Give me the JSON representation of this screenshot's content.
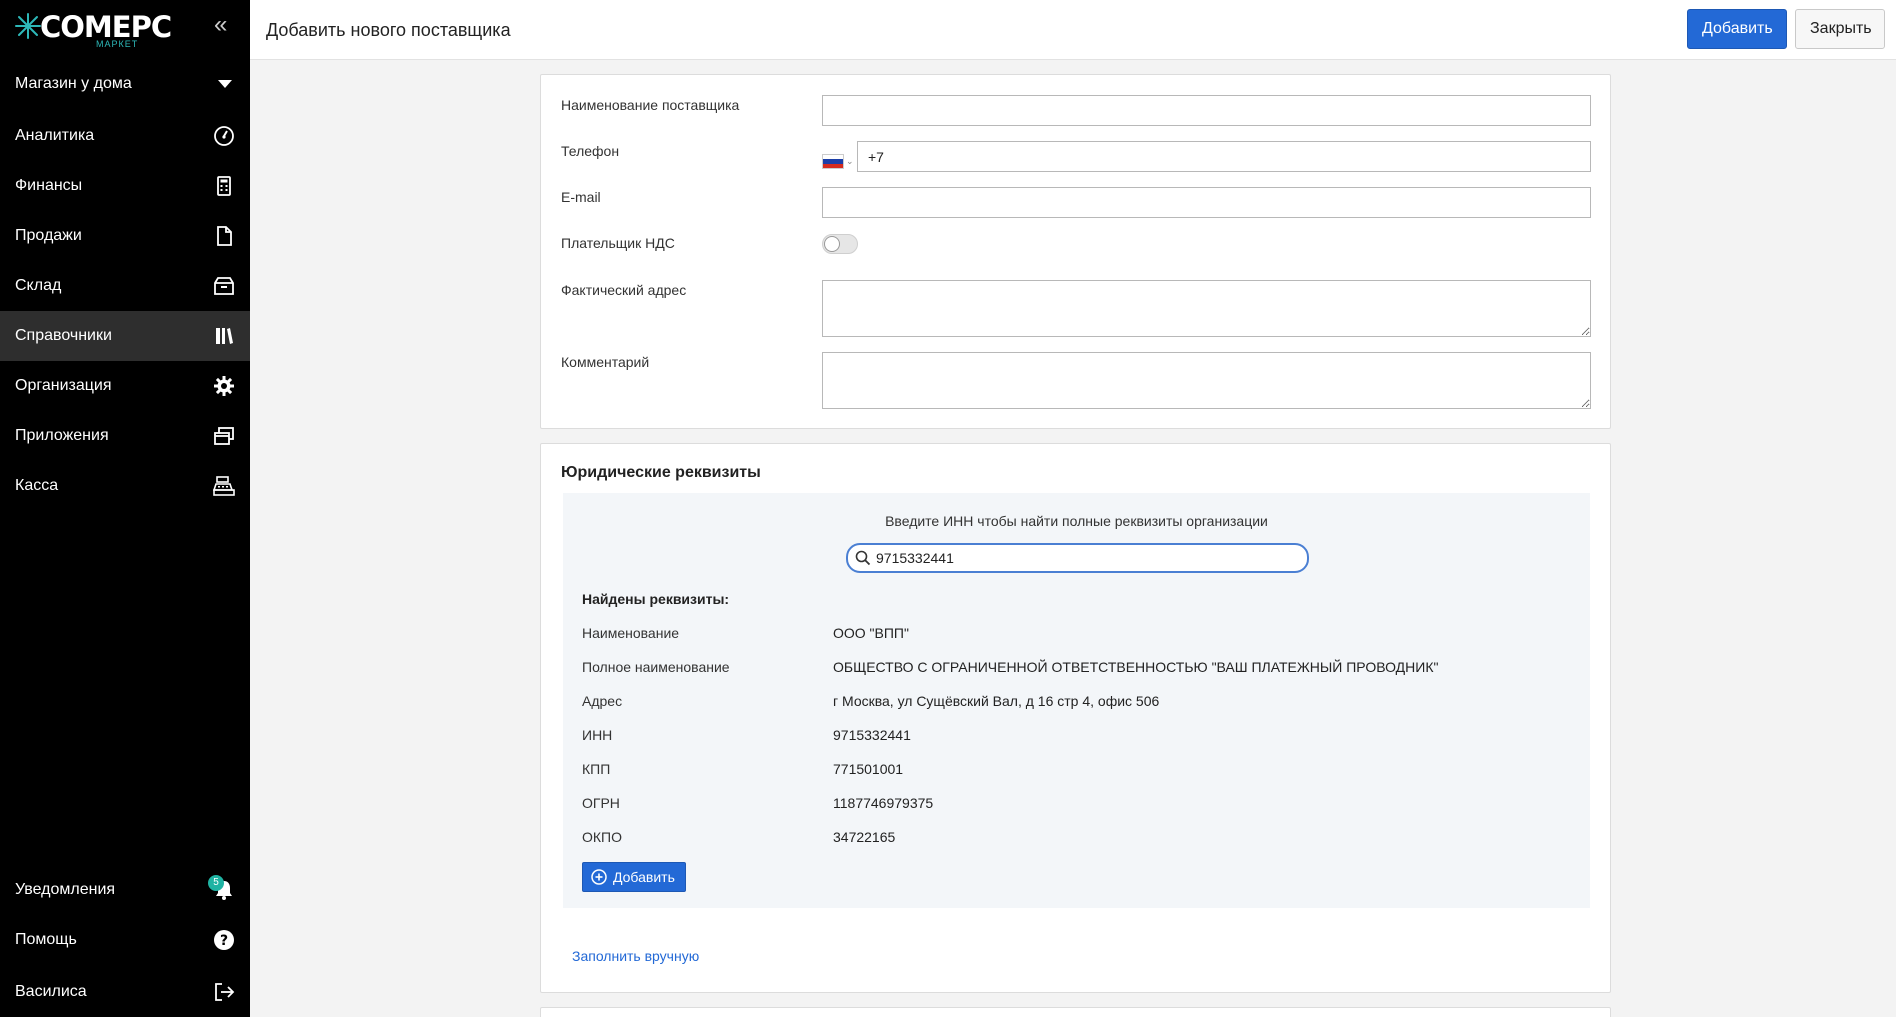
{
  "sidebar": {
    "logo_text": "COMEPC",
    "logo_sub": "МАРКЕТ",
    "store": "Магазин у дома",
    "items": [
      {
        "label": "Аналитика",
        "icon": "gauge-icon"
      },
      {
        "label": "Финансы",
        "icon": "calculator-icon"
      },
      {
        "label": "Продажи",
        "icon": "document-icon"
      },
      {
        "label": "Склад",
        "icon": "box-icon"
      },
      {
        "label": "Справочники",
        "icon": "books-icon",
        "active": true
      },
      {
        "label": "Организация",
        "icon": "gear-icon"
      },
      {
        "label": "Приложения",
        "icon": "windows-icon"
      },
      {
        "label": "Касса",
        "icon": "cash-register-icon"
      }
    ],
    "bottom": {
      "notifications": "Уведомления",
      "notifications_count": "5",
      "help": "Помощь",
      "user": "Василиса"
    }
  },
  "header": {
    "title": "Добавить нового поставщика",
    "add_label": "Добавить",
    "close_label": "Закрыть"
  },
  "form": {
    "name_label": "Наименование поставщика",
    "name_value": "",
    "phone_label": "Телефон",
    "phone_value": "+7",
    "email_label": "E-mail",
    "email_value": "",
    "vat_label": "Плательщик НДС",
    "vat_enabled": false,
    "address_label": "Фактический адрес",
    "comment_label": "Комментарий"
  },
  "legal": {
    "title": "Юридические реквизиты",
    "hint": "Введите ИНН чтобы найти полные реквизиты организации",
    "search_value": "9715332441",
    "found_title": "Найдены реквизиты:",
    "rows": [
      {
        "label": "Наименование",
        "value": "ООО \"ВПП\""
      },
      {
        "label": "Полное наименование",
        "value": "ОБЩЕСТВО С ОГРАНИЧЕННОЙ ОТВЕТСТВЕННОСТЬЮ \"ВАШ ПЛАТЕЖНЫЙ ПРОВОДНИК\""
      },
      {
        "label": "Адрес",
        "value": "г Москва, ул Сущёвский Вал, д 16 стр 4, офис 506"
      },
      {
        "label": "ИНН",
        "value": "9715332441"
      },
      {
        "label": "КПП",
        "value": "771501001"
      },
      {
        "label": "ОГРН",
        "value": "1187746979375"
      },
      {
        "label": "ОКПО",
        "value": "34722165"
      }
    ],
    "add_label": "Добавить",
    "manual_link": "Заполнить вручную"
  },
  "colors": {
    "primary": "#2369d6",
    "sidebar_bg": "#000000",
    "sidebar_active": "#2e2e2e",
    "badge": "#1fb3a3"
  }
}
